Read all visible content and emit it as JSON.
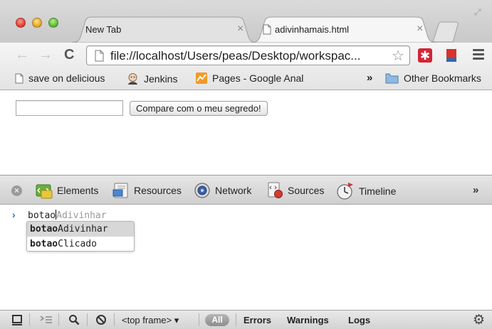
{
  "tabs": [
    {
      "title": "New Tab",
      "active": false
    },
    {
      "title": "adivinhamais.html",
      "active": true
    }
  ],
  "toolbar": {
    "back_glyph": "←",
    "forward_glyph": "→",
    "reload_glyph": "C",
    "url": "file://localhost/Users/peas/Desktop/workspac...",
    "star_glyph": "☆",
    "extension_glyph": "✱"
  },
  "bookmarks": {
    "items": [
      {
        "label": "save on delicious",
        "icon": "page-icon"
      },
      {
        "label": "Jenkins",
        "icon": "jenkins-icon"
      },
      {
        "label": "Pages - Google Anal",
        "icon": "analytics-icon"
      }
    ],
    "overflow": "»",
    "other": "Other Bookmarks"
  },
  "page": {
    "input_value": "",
    "button_label": "Compare com o meu segredo!"
  },
  "devtools": {
    "close_glyph": "×",
    "tabs": [
      "Elements",
      "Resources",
      "Network",
      "Sources",
      "Timeline"
    ],
    "more": "»"
  },
  "console": {
    "prompt": "›",
    "typed": "botao",
    "ghost": "Adivinhar",
    "suggestions": [
      {
        "match": "botao",
        "rest": "Adivinhar",
        "selected": true
      },
      {
        "match": "botao",
        "rest": "Clicado",
        "selected": false
      }
    ]
  },
  "statusbar": {
    "frame": "<top frame> ▾",
    "all": "All",
    "filters": [
      "Errors",
      "Warnings",
      "Logs"
    ]
  },
  "colors": {
    "accent_blue": "#2b6ed3",
    "close_red": "#e0443a",
    "extension_red": "#d42535"
  }
}
